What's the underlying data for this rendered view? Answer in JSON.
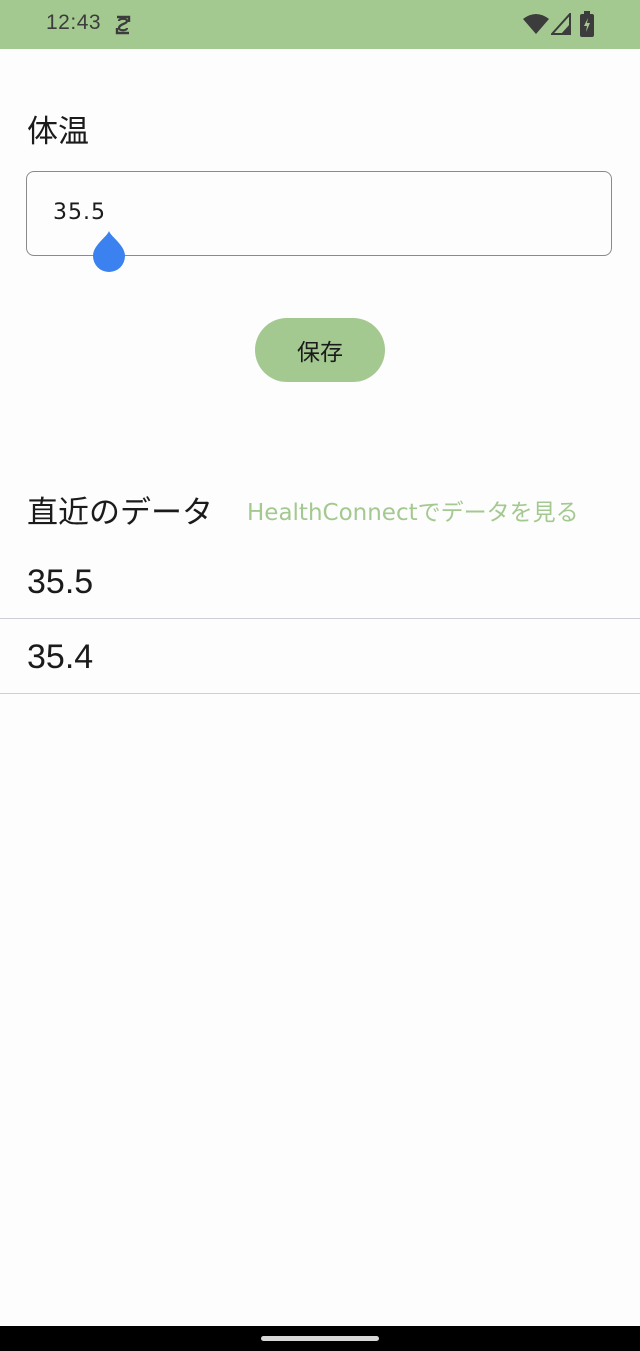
{
  "status_bar": {
    "time": "12:43",
    "icons": [
      "sync-icon",
      "wifi-icon",
      "cellular-signal-icon",
      "battery-charging-icon"
    ],
    "background_color": "#a4c990"
  },
  "form": {
    "title": "体温",
    "input_value": "35.5",
    "save_label": "保存"
  },
  "recent": {
    "title": "直近のデータ",
    "link_label": "HealthConnectでデータを見る",
    "items": [
      {
        "value": "35.5"
      },
      {
        "value": "35.4"
      }
    ]
  },
  "colors": {
    "accent": "#a4c990",
    "cursor_handle": "#3b82f0",
    "text": "#1b1b1b"
  }
}
